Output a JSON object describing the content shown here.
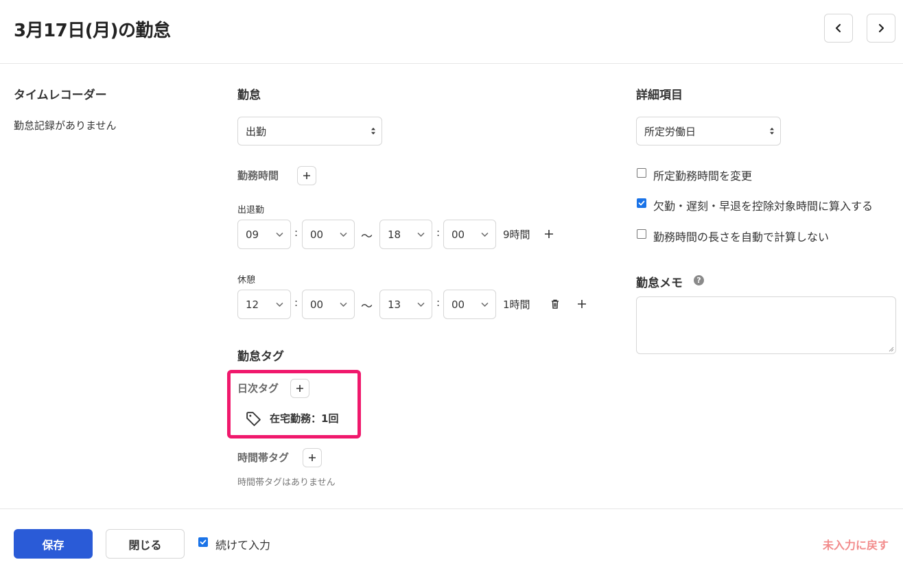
{
  "header": {
    "title": "3月17日(月)の勤怠"
  },
  "timerecorder": {
    "heading": "タイムレコーダー",
    "empty_text": "勤怠記録がありません"
  },
  "attendance": {
    "heading": "勤怠",
    "type_value": "出勤",
    "work_time_label": "勤務時間",
    "clock_label": "出退勤",
    "clock": {
      "start_h": "09",
      "start_m": "00",
      "end_h": "18",
      "end_m": "00",
      "duration": "9時間"
    },
    "break_label": "休憩",
    "break": {
      "start_h": "12",
      "start_m": "00",
      "end_h": "13",
      "end_m": "00",
      "duration": "1時間"
    },
    "colon": ":",
    "tilde": "〜"
  },
  "tags": {
    "heading": "勤怠タグ",
    "daily_label": "日次タグ",
    "daily_tag": "在宅勤務：1回",
    "hourly_label": "時間帯タグ",
    "hourly_empty": "時間帯タグはありません"
  },
  "details": {
    "heading": "詳細項目",
    "day_type_value": "所定労働日",
    "options": [
      {
        "label": "所定勤務時間を変更",
        "checked": false
      },
      {
        "label": "欠勤・遅刻・早退を控除対象時間に算入する",
        "checked": true
      },
      {
        "label": "勤務時間の長さを自動で計算しない",
        "checked": false
      }
    ],
    "memo_label": "勤怠メモ",
    "help_glyph": "?"
  },
  "footer": {
    "save_label": "保存",
    "close_label": "閉じる",
    "continue_label": "続けて入力",
    "continue_checked": true,
    "reset_label": "未入力に戻す"
  },
  "colors": {
    "primary": "#2a5bd7",
    "highlight": "#f0186c",
    "checkbox": "#1a73e8",
    "reset_text": "#f28b8b"
  }
}
